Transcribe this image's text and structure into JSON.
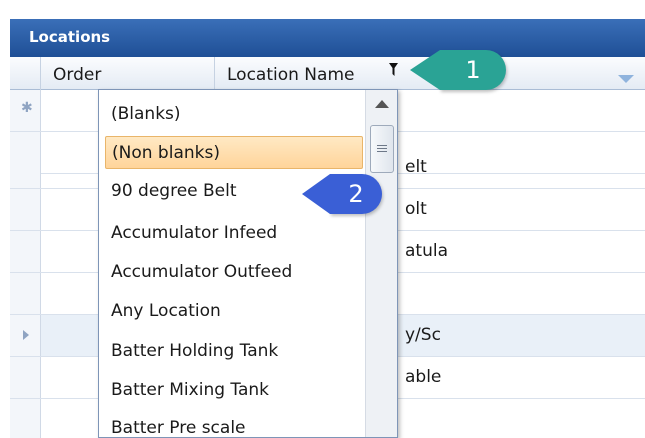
{
  "panel": {
    "title": "Locations"
  },
  "columns": {
    "order": "Order",
    "location_name": "Location Name"
  },
  "filter_dropdown": {
    "items": [
      "(Blanks)",
      "(Non blanks)",
      "90 degree Belt",
      "Accumulator Infeed",
      "Accumulator Outfeed",
      "Any Location",
      "Batter Holding Tank",
      "Batter Mixing Tank",
      "Batter Pre scale"
    ],
    "highlighted_index": 1
  },
  "grid_rows": [
    {
      "location_fragment": ""
    },
    {
      "location_fragment": ""
    },
    {
      "location_fragment": "elt"
    },
    {
      "location_fragment": "olt"
    },
    {
      "location_fragment": "atula"
    },
    {
      "location_fragment": ""
    },
    {
      "location_fragment": "y/Sc"
    },
    {
      "location_fragment": "able"
    }
  ],
  "callouts": {
    "first": "1",
    "second": "2"
  },
  "icons": {
    "filter": "funnel-icon",
    "new_row": "asterisk-icon",
    "current_row": "triangle-right-icon",
    "sort": "chevron-down-icon",
    "scroll_up": "triangle-up-icon"
  },
  "colors": {
    "header_blue": "#2a5ea8",
    "highlight_orange": "#ffd49a",
    "callout_teal": "#2aa395",
    "callout_blue": "#3a5fd6"
  }
}
